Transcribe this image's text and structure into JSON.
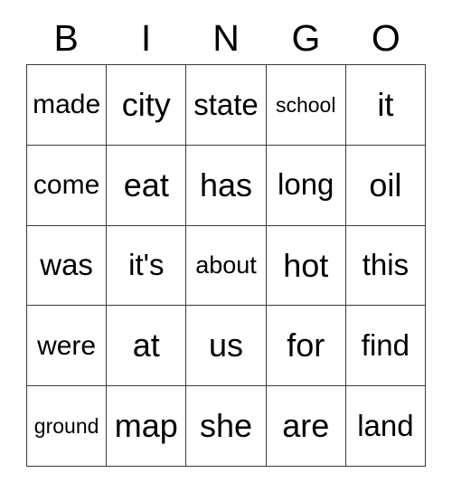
{
  "card": {
    "title": "BINGO",
    "header_letters": [
      "B",
      "I",
      "N",
      "G",
      "O"
    ],
    "columns": 5,
    "rows": 5,
    "colors": {
      "background": "#ffffff",
      "grid_line": "#3a3a3a",
      "text": "#000000"
    },
    "cells": [
      [
        {
          "text": "made",
          "size": "md"
        },
        {
          "text": "city",
          "size": "xl"
        },
        {
          "text": "state",
          "size": "lg"
        },
        {
          "text": "school",
          "size": "xs"
        },
        {
          "text": "it",
          "size": "xl"
        }
      ],
      [
        {
          "text": "come",
          "size": "md"
        },
        {
          "text": "eat",
          "size": "xl"
        },
        {
          "text": "has",
          "size": "xl"
        },
        {
          "text": "long",
          "size": "lg"
        },
        {
          "text": "oil",
          "size": "xl"
        }
      ],
      [
        {
          "text": "was",
          "size": "lg"
        },
        {
          "text": "it's",
          "size": "lg"
        },
        {
          "text": "about",
          "size": "sm"
        },
        {
          "text": "hot",
          "size": "xl"
        },
        {
          "text": "this",
          "size": "lg"
        }
      ],
      [
        {
          "text": "were",
          "size": "md"
        },
        {
          "text": "at",
          "size": "xl"
        },
        {
          "text": "us",
          "size": "xl"
        },
        {
          "text": "for",
          "size": "xl"
        },
        {
          "text": "find",
          "size": "lg"
        }
      ],
      [
        {
          "text": "ground",
          "size": "xs"
        },
        {
          "text": "map",
          "size": "xl"
        },
        {
          "text": "she",
          "size": "xl"
        },
        {
          "text": "are",
          "size": "xl"
        },
        {
          "text": "land",
          "size": "lg"
        }
      ]
    ]
  }
}
